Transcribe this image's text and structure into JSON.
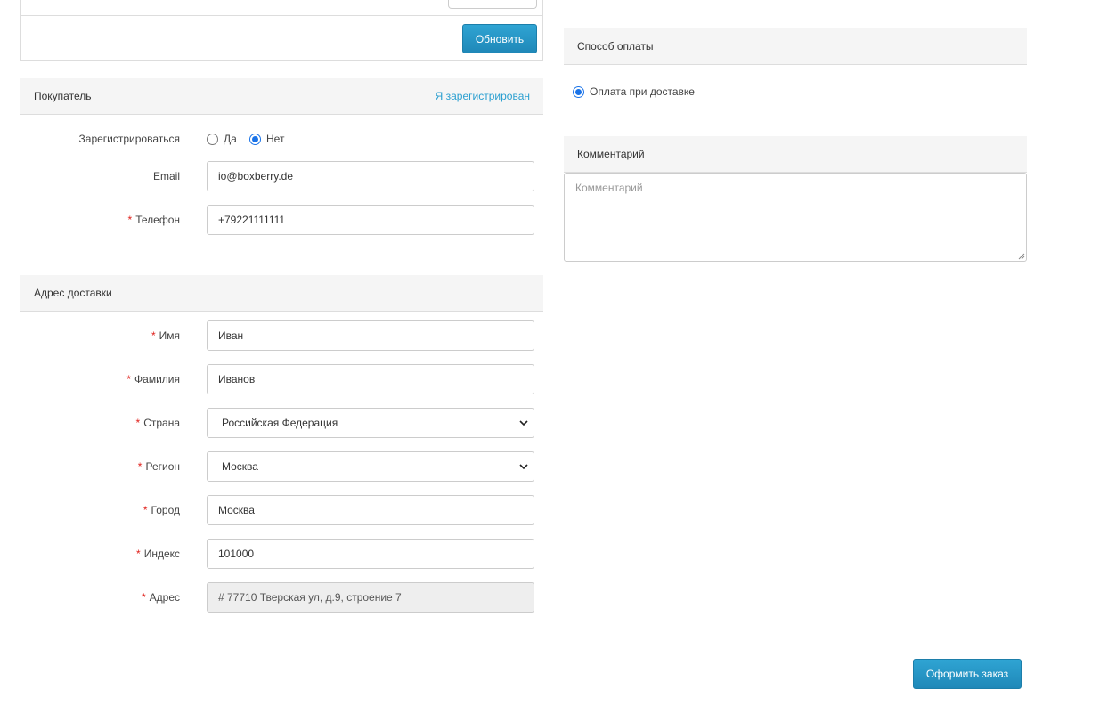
{
  "top": {
    "update_label": "Обновить"
  },
  "buyer": {
    "title": "Покупатель",
    "login_link": "Я зарегистрирован",
    "register_label": "Зарегистрироваться",
    "register_yes": "Да",
    "register_no": "Нет",
    "register_selected": "Нет",
    "email_label": "Email",
    "email_value": "io@boxberry.de",
    "phone_label": "Телефон",
    "phone_value": "+79221111111"
  },
  "address": {
    "title": "Адрес доставки",
    "first_name_label": "Имя",
    "first_name_value": "Иван",
    "last_name_label": "Фамилия",
    "last_name_value": "Иванов",
    "country_label": "Страна",
    "country_value": "Российская Федерация",
    "region_label": "Регион",
    "region_value": "Москва",
    "city_label": "Город",
    "city_value": "Москва",
    "postcode_label": "Индекс",
    "postcode_value": "101000",
    "address_label": "Адрес",
    "address_value": "# 77710 Тверская ул, д.9, строение 7"
  },
  "payment": {
    "title": "Способ оплаты",
    "option_label": "Оплата при доставке",
    "option_selected": true
  },
  "comment": {
    "title": "Комментарий",
    "placeholder": "Комментарий"
  },
  "submit_label": "Оформить заказ",
  "colors": {
    "accent": "#2a9fd0",
    "required": "#e0201b",
    "header_bg": "#f5f5f5",
    "radio_checked": "#1a73e8"
  }
}
